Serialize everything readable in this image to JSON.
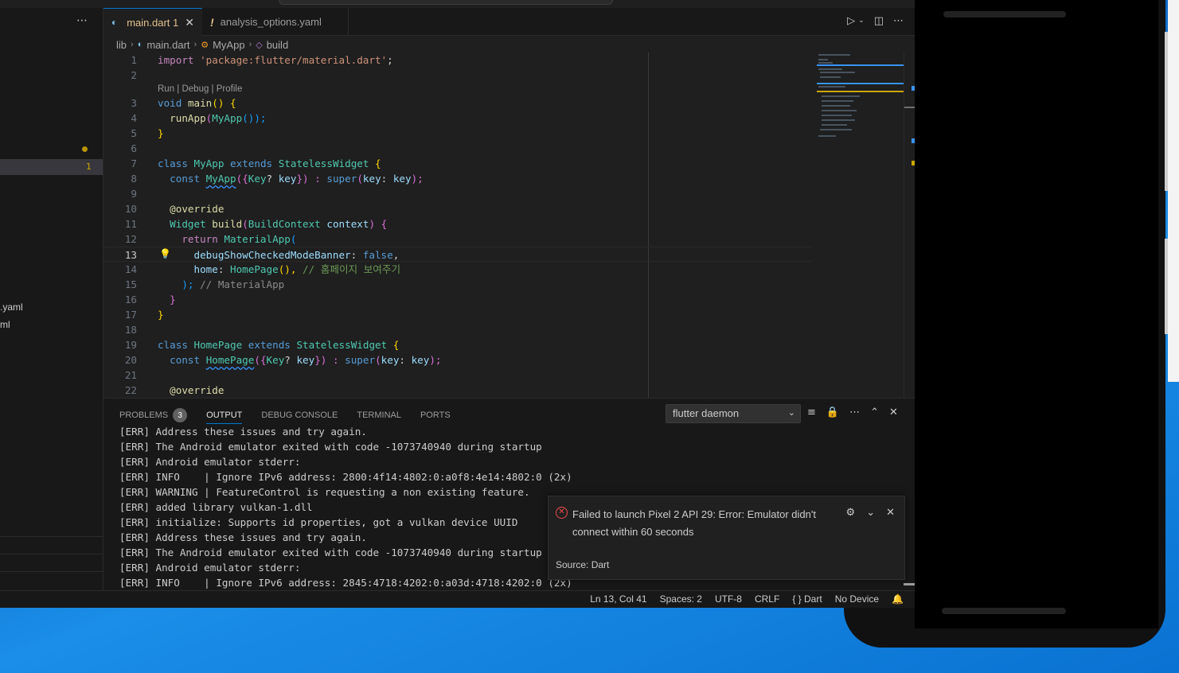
{
  "sidebar": {
    "more_label": "⋯",
    "problem_count": "1",
    "files": [
      ".yaml",
      "ml"
    ]
  },
  "tabs": [
    {
      "label": "main.dart",
      "count": "1",
      "icon": "dart-icon",
      "active": true
    },
    {
      "label": "analysis_options.yaml",
      "icon": "warning-icon",
      "active": false
    }
  ],
  "breadcrumb": [
    "lib",
    "main.dart",
    "MyApp",
    "build"
  ],
  "codelens": "Run | Debug | Profile",
  "code_lines": [
    {
      "n": "1"
    },
    {
      "n": "2"
    },
    {
      "n": "3"
    },
    {
      "n": "4"
    },
    {
      "n": "5"
    },
    {
      "n": "6"
    },
    {
      "n": "7"
    },
    {
      "n": "8"
    },
    {
      "n": "9"
    },
    {
      "n": "10"
    },
    {
      "n": "11"
    },
    {
      "n": "12"
    },
    {
      "n": "13"
    },
    {
      "n": "14"
    },
    {
      "n": "15"
    },
    {
      "n": "16"
    },
    {
      "n": "17"
    },
    {
      "n": "18"
    },
    {
      "n": "19"
    },
    {
      "n": "20"
    },
    {
      "n": "21"
    },
    {
      "n": "22"
    }
  ],
  "code_text": {
    "l1_kw": "import",
    "l1_str": "'package:flutter/material.dart'",
    "l1_end": ";",
    "l3_kw": "void",
    "l3_fn": "main",
    "l3_rest": "() {",
    "l4_fn": "runApp",
    "l4_ty": "MyApp",
    "l4_rest": "());",
    "l5": "}",
    "l7_kw": "class",
    "l7_ty": "MyApp",
    "l7_kw2": "extends",
    "l7_ty2": "StatelessWidget",
    "l7_br": "{",
    "l8_kw": "const",
    "l8_ty": "MyApp",
    "l8_a": "({",
    "l8_ty2": "Key",
    "l8_b": "?",
    "l8_var": "key",
    "l8_c": "}) : ",
    "l8_kw2": "super",
    "l8_d": "(",
    "l8_var2": "key",
    "l8_e": ": ",
    "l8_var3": "key",
    "l8_f": ");",
    "l10": "@override",
    "l11_ty": "Widget",
    "l11_fn": "build",
    "l11_a": "(",
    "l11_ty2": "BuildContext",
    "l11_var": "context",
    "l11_b": ") {",
    "l12_kw": "return",
    "l12_ty": "MaterialApp",
    "l12_a": "(",
    "l13_var": "debugShowCheckedModeBanner",
    "l13_a": ": ",
    "l13_kw": "false",
    "l13_b": ",",
    "l14_var": "home",
    "l14_a": ": ",
    "l14_ty": "HomePage",
    "l14_b": "(), ",
    "l14_cm": "// 홈페이지 보여주기",
    "l15_a": ");",
    "l15_cm": " // MaterialApp",
    "l16": "}",
    "l17": "}",
    "l19_kw": "class",
    "l19_ty": "HomePage",
    "l19_kw2": "extends",
    "l19_ty2": "StatelessWidget",
    "l19_br": "{",
    "l20_kw": "const",
    "l20_ty": "HomePage",
    "l20_a": "({",
    "l20_ty2": "Key",
    "l20_b": "?",
    "l20_var": "key",
    "l20_c": "}) : ",
    "l20_kw2": "super",
    "l20_d": "(",
    "l20_var2": "key",
    "l20_e": ": ",
    "l20_var3": "key",
    "l20_f": ");",
    "l22": "@override"
  },
  "panel": {
    "tabs": [
      "PROBLEMS",
      "OUTPUT",
      "DEBUG CONSOLE",
      "TERMINAL",
      "PORTS"
    ],
    "problems_badge": "3",
    "channel": "flutter daemon",
    "output_lines": [
      "[ERR] Address these issues and try again.",
      "[ERR] The Android emulator exited with code -1073740940 during startup",
      "[ERR] Android emulator stderr:",
      "[ERR] INFO    | Ignore IPv6 address: 2800:4f14:4802:0:a0f8:4e14:4802:0 (2x)",
      "[ERR] WARNING | FeatureControl is requesting a non existing feature.",
      "[ERR] added library vulkan-1.dll",
      "[ERR] initialize: Supports id properties, got a vulkan device UUID",
      "[ERR] Address these issues and try again.",
      "[ERR] The Android emulator exited with code -1073740940 during startup",
      "[ERR] Android emulator stderr:",
      "[ERR] INFO    | Ignore IPv6 address: 2845:4718:4202:0:a03d:4718:4202:0 (2x)"
    ]
  },
  "notification": {
    "message": "Failed to launch Pixel 2 API 29: Error: Emulator didn't connect within 60 seconds",
    "source": "Source: Dart"
  },
  "status": {
    "position": "Ln 13, Col 41",
    "spaces": "Spaces: 2",
    "encoding": "UTF-8",
    "eol": "CRLF",
    "language": "Dart",
    "device": "No Device"
  },
  "colors": {
    "accent": "#0078d4",
    "error": "#f14c4c",
    "warning": "#cca700"
  }
}
